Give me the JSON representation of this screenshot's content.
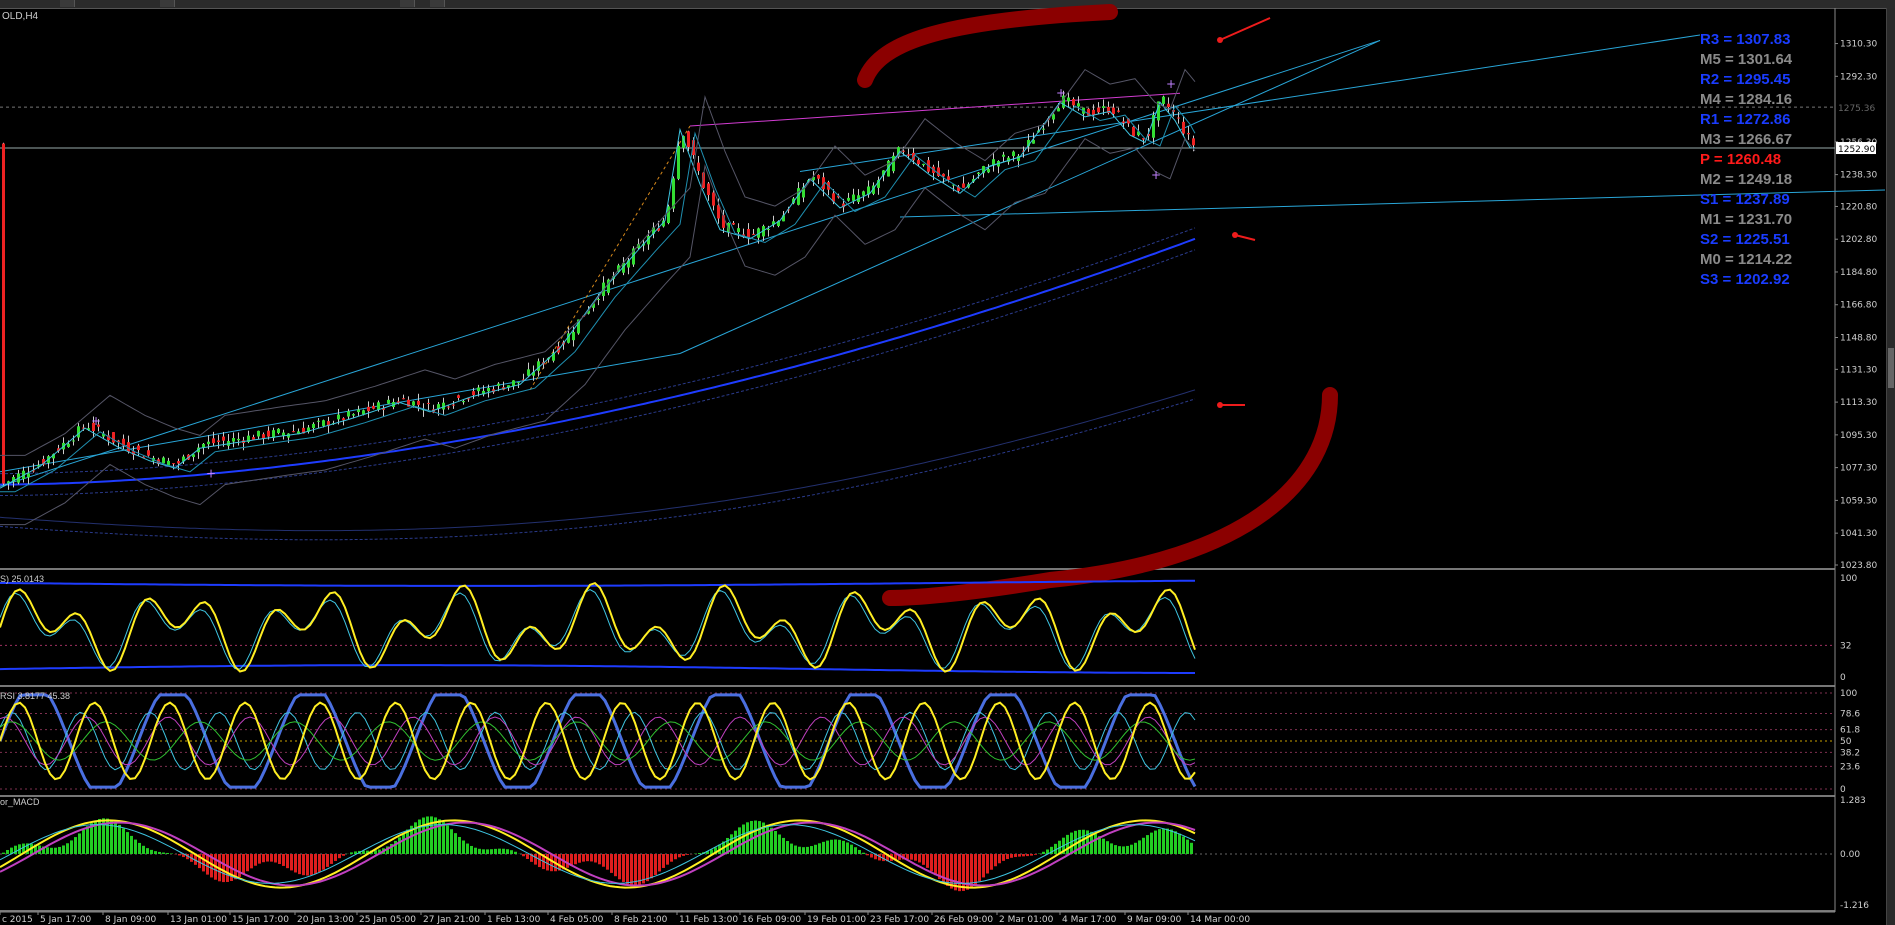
{
  "chart_title": "OLD,H4",
  "pivots": [
    {
      "label": "R3 = 1307.83",
      "color": "#1a3cff"
    },
    {
      "label": "M5 = 1301.64",
      "color": "#8a8a8a"
    },
    {
      "label": "R2 = 1295.45",
      "color": "#1a3cff"
    },
    {
      "label": "M4 = 1284.16",
      "color": "#8a8a8a"
    },
    {
      "label": "R1 = 1272.86",
      "color": "#1a3cff"
    },
    {
      "label": "M3 = 1266.67",
      "color": "#8a8a8a"
    },
    {
      "label": "P  = 1260.48",
      "color": "#ff1a1a"
    },
    {
      "label": "M2 = 1249.18",
      "color": "#8a8a8a"
    },
    {
      "label": "S1 = 1237.89",
      "color": "#1a3cff"
    },
    {
      "label": "M1 = 1231.70",
      "color": "#8a8a8a"
    },
    {
      "label": "S2 = 1225.51",
      "color": "#1a3cff"
    },
    {
      "label": "M0 = 1214.22",
      "color": "#8a8a8a"
    },
    {
      "label": "S3 = 1202.92",
      "color": "#1a3cff"
    }
  ],
  "indicator_labels": {
    "stoch": "S) 25.0143",
    "rsi": "RSI 3.8177 45.38",
    "macd": "or_MACD"
  },
  "price_marks": {
    "current": "1252.90",
    "upper": "1275.36"
  },
  "chart_data": {
    "type": "candlestick",
    "symbol": "GOLD",
    "timeframe": "H4",
    "y_axis_main": [
      "1310.30",
      "1292.30",
      "1256.30",
      "1238.30",
      "1220.80",
      "1202.80",
      "1184.80",
      "1166.80",
      "1148.80",
      "1131.30",
      "1113.30",
      "1095.30",
      "1077.30",
      "1059.30",
      "1041.30",
      "1023.80"
    ],
    "y_axis_stoch": [
      "100",
      "32",
      "0"
    ],
    "y_axis_rsi": [
      "100",
      "78.6",
      "61.8",
      "50",
      "38.2",
      "23.6",
      "0"
    ],
    "y_axis_macd": [
      "1.283",
      "0.00",
      "-1.216"
    ],
    "x_axis_labels": [
      "c 2015",
      "5 Jan 17:00",
      "8 Jan 09:00",
      "13 Jan 01:00",
      "15 Jan 17:00",
      "20 Jan 13:00",
      "25 Jan 05:00",
      "27 Jan 21:00",
      "1 Feb 13:00",
      "4 Feb 05:00",
      "8 Feb 21:00",
      "11 Feb 13:00",
      "16 Feb 09:00",
      "19 Feb 01:00",
      "23 Feb 17:00",
      "26 Feb 09:00",
      "2 Mar 01:00",
      "4 Mar 17:00",
      "9 Mar 09:00",
      "14 Mar 00:00"
    ],
    "ylim": [
      1023.8,
      1315
    ],
    "close_anchors": [
      [
        0,
        1068
      ],
      [
        40,
        1080
      ],
      [
        85,
        1101
      ],
      [
        120,
        1090
      ],
      [
        150,
        1083
      ],
      [
        175,
        1079
      ],
      [
        200,
        1090
      ],
      [
        260,
        1095
      ],
      [
        300,
        1098
      ],
      [
        350,
        1106
      ],
      [
        400,
        1115
      ],
      [
        430,
        1110
      ],
      [
        470,
        1118
      ],
      [
        520,
        1125
      ],
      [
        560,
        1145
      ],
      [
        600,
        1175
      ],
      [
        640,
        1200
      ],
      [
        665,
        1215
      ],
      [
        680,
        1265
      ],
      [
        700,
        1235
      ],
      [
        720,
        1210
      ],
      [
        750,
        1205
      ],
      [
        780,
        1215
      ],
      [
        810,
        1238
      ],
      [
        840,
        1222
      ],
      [
        870,
        1230
      ],
      [
        900,
        1253
      ],
      [
        930,
        1240
      ],
      [
        960,
        1230
      ],
      [
        990,
        1245
      ],
      [
        1020,
        1250
      ],
      [
        1040,
        1265
      ],
      [
        1060,
        1280
      ],
      [
        1085,
        1272
      ],
      [
        1110,
        1275
      ],
      [
        1130,
        1262
      ],
      [
        1145,
        1258
      ],
      [
        1160,
        1280
      ],
      [
        1175,
        1270
      ],
      [
        1190,
        1255
      ]
    ]
  }
}
